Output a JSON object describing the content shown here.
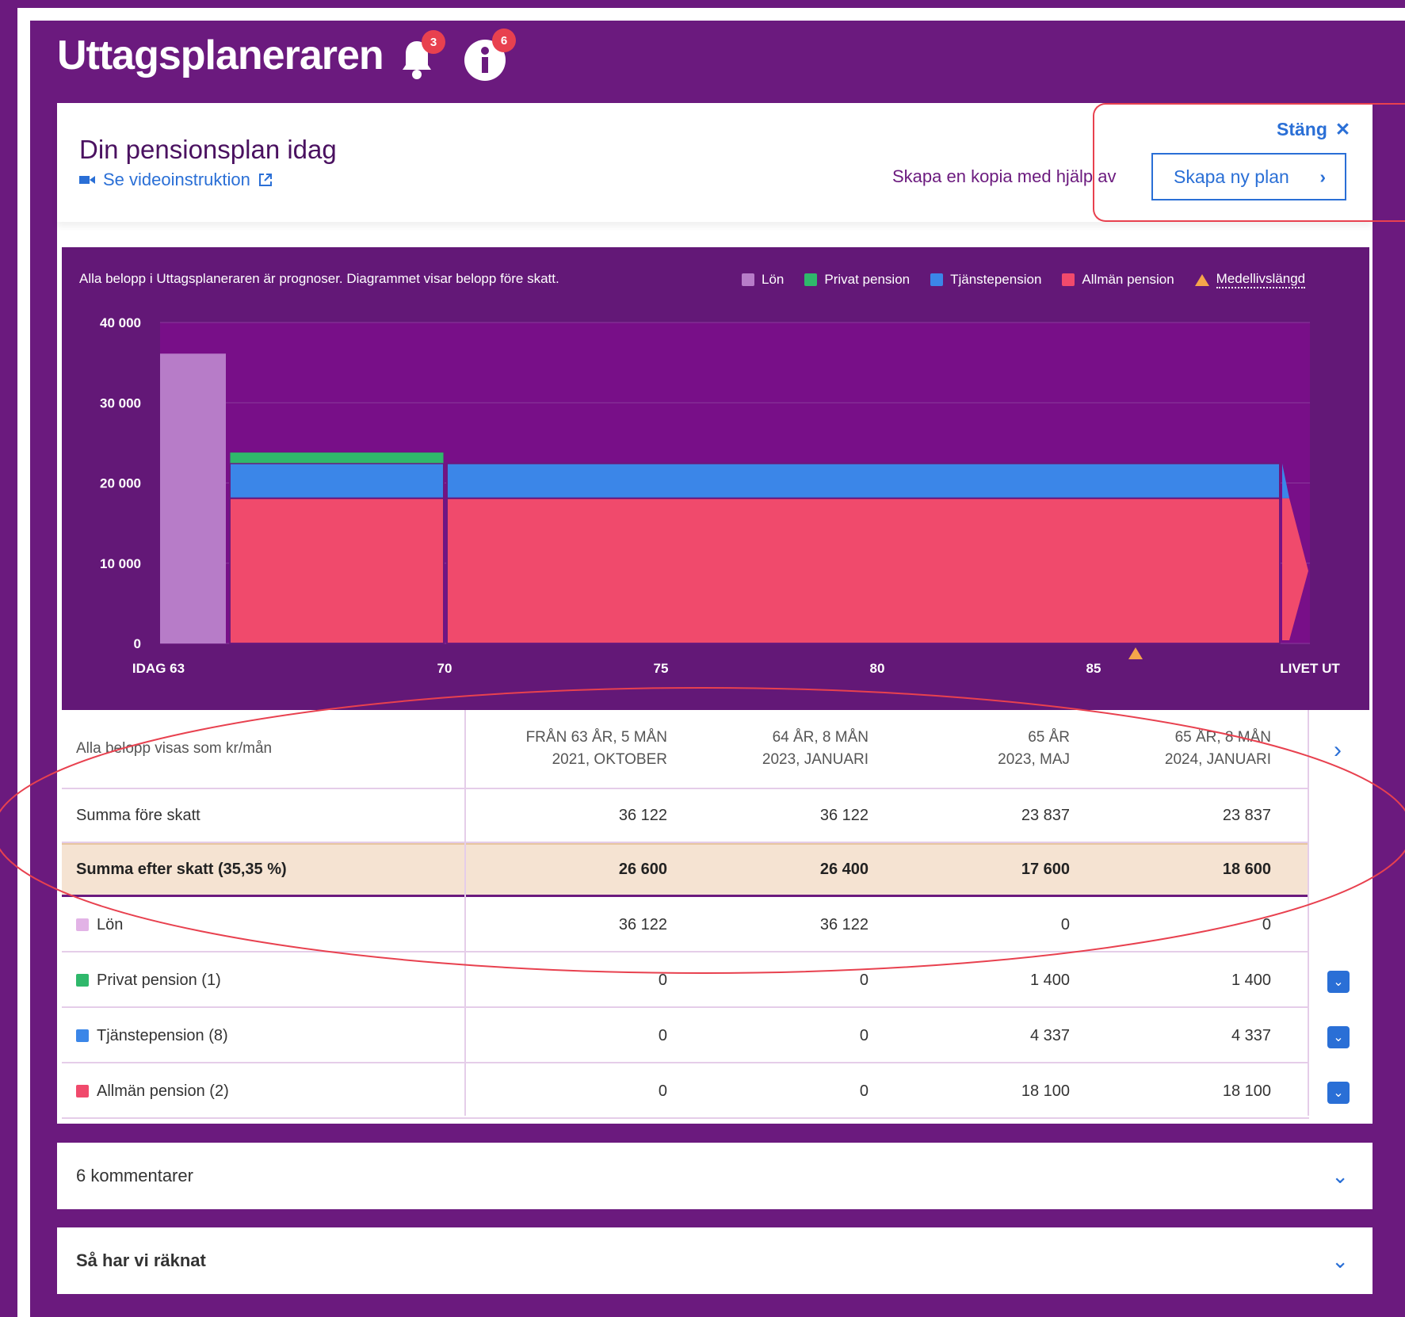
{
  "app": {
    "title": "Uttagsplaneraren",
    "notifications_badge": "3",
    "info_badge": "6"
  },
  "plan": {
    "title": "Din pensionsplan idag",
    "video_link": "Se videoinstruktion",
    "copy_text": "Skapa en kopia med hjälp av",
    "new_plan_button": "Skapa ny plan",
    "close_label": "Stäng"
  },
  "chart_note": "Alla belopp i Uttagsplaneraren är prognoser. Diagrammet visar belopp före skatt.",
  "legend": [
    {
      "label": "Lön",
      "color": "#b77cc8"
    },
    {
      "label": "Privat pension",
      "color": "#2fb86b"
    },
    {
      "label": "Tjänstepension",
      "color": "#3b86e8"
    },
    {
      "label": "Allmän pension",
      "color": "#f04a6c"
    },
    {
      "label": "Medellivslängd",
      "color": "#f5a54a"
    }
  ],
  "chart_data": {
    "type": "area",
    "y_ticks": [
      "40 000",
      "30 000",
      "20 000",
      "10 000",
      "0"
    ],
    "ylim": [
      0,
      40000
    ],
    "x_ticks": [
      "IDAG 63",
      "70",
      "75",
      "80",
      "85",
      "LIVET UT"
    ],
    "series": [
      {
        "name": "Lön",
        "segments": [
          {
            "from": "IDAG 63",
            "to": 64.7,
            "value": 36122
          }
        ]
      },
      {
        "name": "Allmän pension",
        "segments": [
          {
            "from": 65,
            "to": "LIVET UT",
            "value": 18100
          }
        ]
      },
      {
        "name": "Tjänstepension",
        "segments": [
          {
            "from": 65,
            "to": "LIVET UT",
            "value": 4337
          }
        ]
      },
      {
        "name": "Privat pension",
        "segments": [
          {
            "from": 65,
            "to": 70,
            "value": 1400
          }
        ]
      }
    ],
    "life_expectancy_marker": 86
  },
  "table": {
    "note": "Alla belopp visas som kr/mån",
    "columns": [
      {
        "line1": "FRÅN 63 ÅR, 5 MÅN",
        "line2": "2021, OKTOBER"
      },
      {
        "line1": "64 ÅR, 8 MÅN",
        "line2": "2023, JANUARI"
      },
      {
        "line1": "65 ÅR",
        "line2": "2023, MAJ"
      },
      {
        "line1": "65 ÅR, 8 MÅN",
        "line2": "2024, JANUARI"
      }
    ],
    "rows": [
      {
        "label": "Summa före skatt",
        "values": [
          "36 122",
          "36 122",
          "23 837",
          "23 837"
        ]
      },
      {
        "label": "Summa efter skatt (35,35 %)",
        "values": [
          "26 600",
          "26 400",
          "17 600",
          "18 600"
        ]
      },
      {
        "label": "Lön",
        "values": [
          "36 122",
          "36 122",
          "0",
          "0"
        ],
        "color": "#e2b3e6"
      },
      {
        "label": "Privat pension (1)",
        "values": [
          "0",
          "0",
          "1 400",
          "1 400"
        ],
        "color": "#2fb86b"
      },
      {
        "label": "Tjänstepension (8)",
        "values": [
          "0",
          "0",
          "4 337",
          "4 337"
        ],
        "color": "#3b86e8"
      },
      {
        "label": "Allmän pension (2)",
        "values": [
          "0",
          "0",
          "18 100",
          "18 100"
        ],
        "color": "#f04a6c"
      }
    ]
  },
  "accordions": [
    {
      "label": "6 kommentarer"
    },
    {
      "label": "Så har vi räknat"
    }
  ]
}
